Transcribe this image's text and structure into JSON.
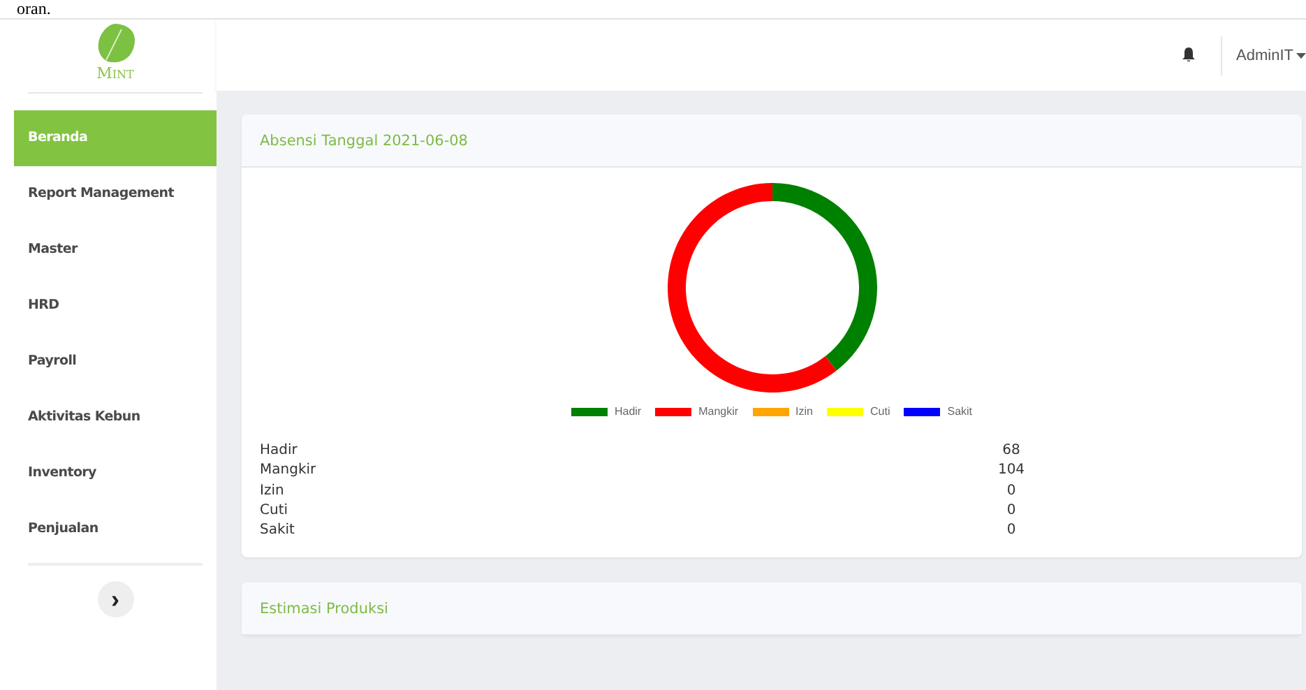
{
  "top_fragment": "oran.",
  "sidebar": {
    "logo_text": "Mint",
    "items": [
      {
        "label": "Beranda",
        "selected": true
      },
      {
        "label": "Report Management",
        "selected": false
      },
      {
        "label": "Master",
        "selected": false
      },
      {
        "label": "HRD",
        "selected": false
      },
      {
        "label": "Payroll",
        "selected": false
      },
      {
        "label": "Aktivitas Kebun",
        "selected": false
      },
      {
        "label": "Inventory",
        "selected": false
      },
      {
        "label": "Penjualan",
        "selected": false
      }
    ],
    "toggle": "›"
  },
  "header": {
    "user": "AdminIT"
  },
  "cards": [
    {
      "title": "Absensi Tanggal 2021-06-08",
      "chart_data": {
        "type": "donut",
        "categories": [
          "Hadir",
          "Mangkir",
          "Izin",
          "Cuti",
          "Sakit"
        ],
        "values": [
          39.53,
          60.47,
          0,
          0,
          0
        ],
        "legend": "bottom",
        "colors": [
          "#008000",
          "#ff0000",
          "#ffa500",
          "#ffff00",
          "#0000ff"
        ]
      },
      "rows": [
        {
          "label": "Hadir",
          "value": "68"
        },
        {
          "label": "Mangkir",
          "value": "104"
        },
        {
          "label": "Izin",
          "value": "0"
        },
        {
          "label": "Cuti",
          "value": "0"
        },
        {
          "label": "Sakit",
          "value": "0"
        }
      ]
    },
    {
      "title": "Estimasi Produksi"
    }
  ]
}
